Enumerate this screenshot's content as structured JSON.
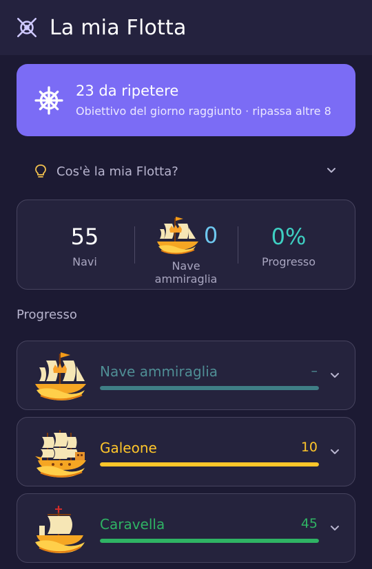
{
  "header": {
    "title": "La mia Flotta",
    "icon": "ship-wheel-icon"
  },
  "review": {
    "title": "23 da ripetere",
    "subtitle": "Obiettivo del giorno raggiunto · ripassa altre 8",
    "color": "#7b6cf5"
  },
  "faq": {
    "label": "Cos'è la mia Flotta?",
    "icon": "lightbulb-icon"
  },
  "stats": {
    "ships": {
      "value": "55",
      "label": "Navi"
    },
    "flagship": {
      "value": "0",
      "label": "Nave ammiraglia"
    },
    "progress": {
      "value": "0%",
      "label": "Progresso"
    }
  },
  "progress_section": {
    "title": "Progresso",
    "ranks": [
      {
        "name": "Nave ammiraglia",
        "count": "–",
        "fill": 1.0,
        "color": "#3f7e86",
        "text_color": "#4f8e95",
        "icon": "flagship-icon"
      },
      {
        "name": "Galeone",
        "count": "10",
        "fill": 1.0,
        "color": "#ffc62a",
        "text_color": "#ffc62a",
        "icon": "galleon-icon"
      },
      {
        "name": "Caravella",
        "count": "45",
        "fill": 1.0,
        "color": "#2fb364",
        "text_color": "#2fb364",
        "icon": "caravel-icon"
      }
    ]
  }
}
